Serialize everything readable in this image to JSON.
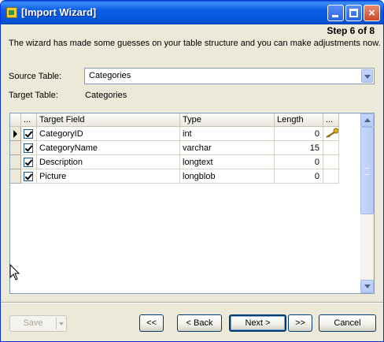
{
  "window": {
    "title": "[Import Wizard]",
    "controls": {
      "minimize": "minimize-icon",
      "maximize": "maximize-icon",
      "close": "×"
    }
  },
  "step": "Step 6 of 8",
  "description": "The wizard has made some guesses on your table structure and you can make adjustments now.",
  "source_table": {
    "label": "Source Table:",
    "value": "Categories"
  },
  "target_table": {
    "label": "Target Table:",
    "value": "Categories"
  },
  "grid": {
    "columns": [
      "...",
      "Target Field",
      "Type",
      "Length",
      "..."
    ],
    "rows": [
      {
        "checked": true,
        "field": "CategoryID",
        "type": "int",
        "length": "0",
        "primary_key": true,
        "current": true
      },
      {
        "checked": true,
        "field": "CategoryName",
        "type": "varchar",
        "length": "15",
        "primary_key": false,
        "current": false
      },
      {
        "checked": true,
        "field": "Description",
        "type": "longtext",
        "length": "0",
        "primary_key": false,
        "current": false
      },
      {
        "checked": true,
        "field": "Picture",
        "type": "longblob",
        "length": "0",
        "primary_key": false,
        "current": false
      }
    ]
  },
  "buttons": {
    "save": "Save",
    "first": "<<",
    "back": "< Back",
    "next": "Next >",
    "last": ">>",
    "cancel": "Cancel"
  },
  "colors": {
    "titlebar": "#0553d6",
    "dialog_bg": "#ece9d8",
    "field_border": "#7f9db9",
    "disabled_text": "#aca899"
  }
}
